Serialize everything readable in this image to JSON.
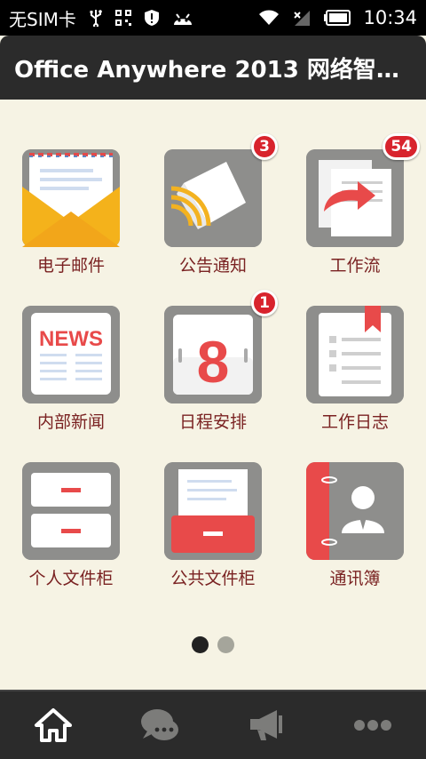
{
  "status_bar": {
    "carrier": "无SIM卡",
    "time": "10:34",
    "icons": [
      "usb-icon",
      "qr-icon",
      "shield-icon",
      "android-icon",
      "wifi-icon",
      "signal-icon",
      "battery-icon"
    ]
  },
  "header": {
    "title": "Office Anywhere 2013 网络智能..."
  },
  "apps": [
    {
      "label": "电子邮件",
      "icon": "mail-icon",
      "badge": ""
    },
    {
      "label": "公告通知",
      "icon": "megaphone-icon",
      "badge": "3"
    },
    {
      "label": "工作流",
      "icon": "workflow-icon",
      "badge": "54"
    },
    {
      "label": "内部新闻",
      "icon": "news-icon",
      "badge": "",
      "icon_text": "NEWS"
    },
    {
      "label": "日程安排",
      "icon": "calendar-icon",
      "badge": "1",
      "icon_text": "8"
    },
    {
      "label": "工作日志",
      "icon": "journal-icon",
      "badge": ""
    },
    {
      "label": "个人文件柜",
      "icon": "cabinet-icon",
      "badge": ""
    },
    {
      "label": "公共文件柜",
      "icon": "shared-cabinet-icon",
      "badge": ""
    },
    {
      "label": "通讯簿",
      "icon": "contacts-icon",
      "badge": ""
    }
  ],
  "pager": {
    "pages": 2,
    "current": 1
  },
  "bottom_nav": [
    "home-icon",
    "chat-icon",
    "announce-icon",
    "more-icon"
  ],
  "colors": {
    "label": "#7a2222",
    "badge": "#d8232d",
    "accent_red": "#e84a4a",
    "tile_gray": "#8e8e8c",
    "background": "#f6f3e4"
  }
}
